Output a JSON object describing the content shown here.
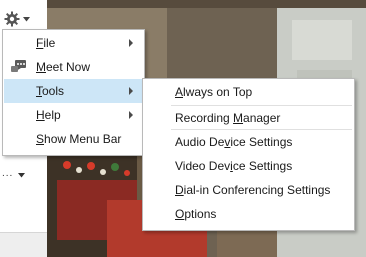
{
  "menu": {
    "items": [
      {
        "pre": "",
        "key": "F",
        "post": "ile",
        "has_submenu": true
      },
      {
        "pre": "",
        "key": "M",
        "post": "eet Now",
        "has_submenu": false
      },
      {
        "pre": "",
        "key": "T",
        "post": "ools",
        "has_submenu": true
      },
      {
        "pre": "",
        "key": "H",
        "post": "elp",
        "has_submenu": true
      },
      {
        "pre": "",
        "key": "S",
        "post": "how Menu Bar",
        "has_submenu": false
      }
    ]
  },
  "submenu": {
    "items": [
      {
        "pre": "",
        "key": "A",
        "post": "lways on Top"
      },
      {
        "pre": "Recording ",
        "key": "M",
        "post": "anager"
      },
      {
        "pre": "Audio De",
        "key": "v",
        "post": "ice Settings"
      },
      {
        "pre": "Video Dev",
        "key": "i",
        "post": "ce Settings"
      },
      {
        "pre": "",
        "key": "D",
        "post": "ial-in Conferencing Settings"
      },
      {
        "pre": "",
        "key": "O",
        "post": "ptions"
      }
    ]
  },
  "left": {
    "ellipsis": "..."
  },
  "colors": {
    "selection": "#cde6f7",
    "menu_border": "#b9b9b9"
  },
  "icons": [
    "gear-icon",
    "chevron-down-icon",
    "meet-now-icon",
    "submenu-arrow-icon"
  ]
}
